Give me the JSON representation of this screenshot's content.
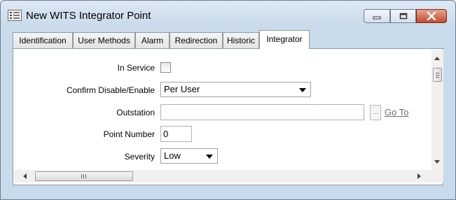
{
  "window": {
    "title": "New WITS Integrator Point",
    "icon": "points-grid-icon"
  },
  "tabs": [
    {
      "label": "Identification",
      "active": false
    },
    {
      "label": "User Methods",
      "active": false
    },
    {
      "label": "Alarm",
      "active": false
    },
    {
      "label": "Redirection",
      "active": false
    },
    {
      "label": "Historic",
      "active": false
    },
    {
      "label": "Integrator",
      "active": true
    }
  ],
  "form": {
    "in_service": {
      "label": "In Service",
      "checked": false
    },
    "confirm_disable_enable": {
      "label": "Confirm Disable/Enable",
      "value": "Per User"
    },
    "outstation": {
      "label": "Outstation",
      "value": "",
      "browse_label": "...",
      "goto_label": "Go To"
    },
    "point_number": {
      "label": "Point Number",
      "value": "0"
    },
    "severity": {
      "label": "Severity",
      "value": "Low"
    }
  },
  "colors": {
    "title_bg": "#c9daea",
    "close_button": "#c7492d",
    "link": "#6d6d6d"
  }
}
